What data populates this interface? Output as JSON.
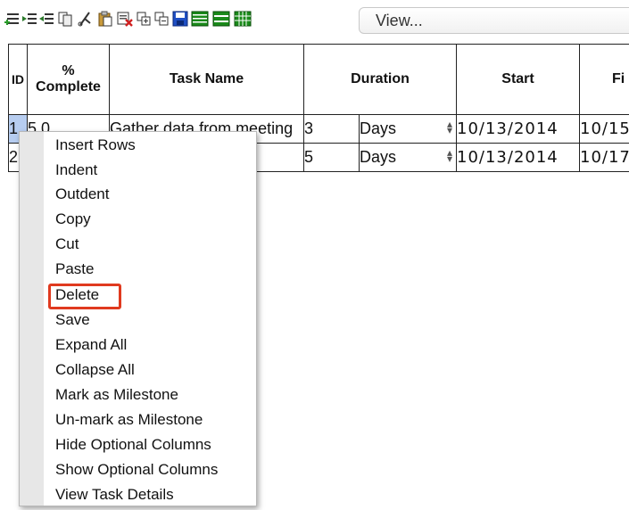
{
  "toolbar": {
    "view_label": "View...",
    "buttons": [
      {
        "name": "insert-rows-icon"
      },
      {
        "name": "indent-icon"
      },
      {
        "name": "outdent-icon"
      },
      {
        "name": "copy-icon"
      },
      {
        "name": "cut-icon"
      },
      {
        "name": "paste-icon"
      },
      {
        "name": "delete-icon"
      },
      {
        "name": "expand-all-icon"
      },
      {
        "name": "collapse-all-icon"
      },
      {
        "name": "save-icon"
      },
      {
        "name": "view-1-icon"
      },
      {
        "name": "view-2-icon"
      },
      {
        "name": "view-3-icon"
      }
    ]
  },
  "grid": {
    "headers": {
      "id": "ID",
      "percent_complete": "% Complete",
      "task_name": "Task Name",
      "duration": "Duration",
      "start": "Start",
      "finish": "Fi"
    },
    "rows": [
      {
        "id": "1",
        "pct": "5 0",
        "task": "Gather data from meeting",
        "duration": "3",
        "unit": "Days",
        "start": "10/13/2014",
        "finish": "10/15"
      },
      {
        "id": "2",
        "pct": "",
        "task": "",
        "duration": "5",
        "unit": "Days",
        "start": "10/13/2014",
        "finish": "10/17"
      }
    ]
  },
  "context_menu": {
    "items": [
      "Insert Rows",
      "Indent",
      "Outdent",
      "Copy",
      "Cut",
      "Paste",
      "Delete",
      "Save",
      "Expand All",
      "Collapse All",
      "Mark as Milestone",
      "Un-mark as Milestone",
      "Hide Optional Columns",
      "Show Optional Columns",
      "View Task Details"
    ],
    "highlighted_item": "Delete",
    "highlight_color": "#e03a1f"
  }
}
